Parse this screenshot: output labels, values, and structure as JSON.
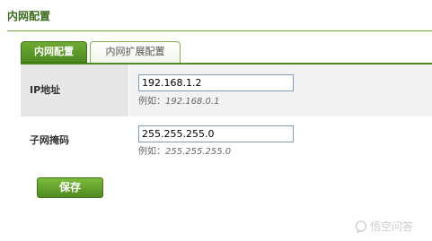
{
  "header": {
    "title": "内网配置"
  },
  "tabs": [
    {
      "label": "内网配置",
      "active": true
    },
    {
      "label": "内网扩展配置",
      "active": false
    }
  ],
  "form": {
    "ip": {
      "label": "IP地址",
      "value": "192.168.1.2",
      "hint_prefix": "例如：",
      "hint_example": "192.168.0.1"
    },
    "mask": {
      "label": "子网掩码",
      "value": "255.255.255.0",
      "hint_prefix": "例如：",
      "hint_example": "255.255.255.0"
    }
  },
  "actions": {
    "save_label": "保存"
  },
  "watermark": {
    "text": "悟空问答"
  },
  "colors": {
    "accent": "#4e8a1f",
    "title": "#3d6b1e",
    "band": "#f2f2f2"
  }
}
